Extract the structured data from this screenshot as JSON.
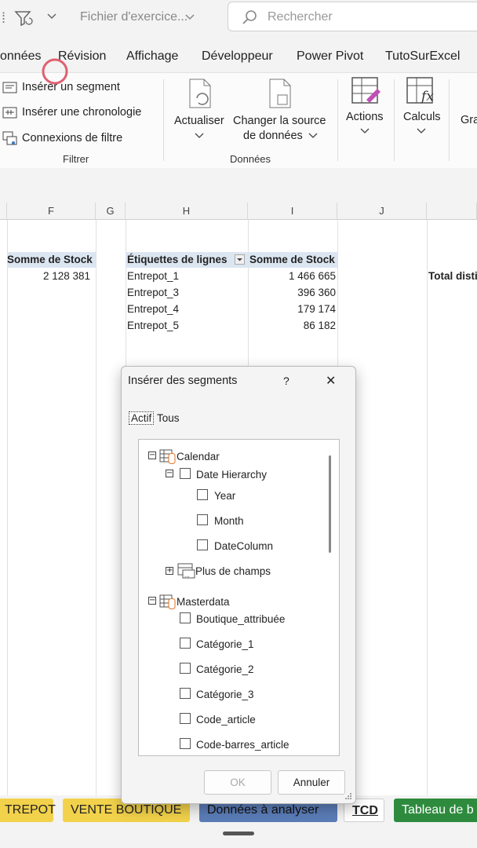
{
  "titlebar": {
    "filename": "Fichier d'exercice...",
    "search_placeholder": "Rechercher"
  },
  "menu": [
    "onnées",
    "Révision",
    "Affichage",
    "Développeur",
    "Power Pivot",
    "TutoSurExcel"
  ],
  "ribbon": {
    "filter_group": {
      "insert_slicer": "Insérer un segment",
      "insert_timeline": "Insérer une chronologie",
      "filter_connections": "Connexions de filtre",
      "label": "Filtrer"
    },
    "data_group": {
      "refresh": "Actualiser",
      "change_source_line1": "Changer la source",
      "change_source_line2": "de données",
      "label": "Données"
    },
    "actions": "Actions",
    "calculs": "Calculs",
    "gra": "Gra"
  },
  "sheet": {
    "columns": [
      "F",
      "G",
      "H",
      "I",
      "J"
    ],
    "f_header": "Somme de Stock",
    "f_value": "2 128 381",
    "row_labels_header": "Étiquettes de lignes",
    "sum_header": "Somme de Stock",
    "rows": [
      {
        "label": "Entrepot_1",
        "value": "1 466 665"
      },
      {
        "label": "Entrepot_3",
        "value": "396 360"
      },
      {
        "label": "Entrepot_4",
        "value": "179 174"
      },
      {
        "label": "Entrepot_5",
        "value": "86 182"
      }
    ],
    "total_text": "Total disti"
  },
  "sheet_tabs": [
    {
      "label": "TREPOT",
      "color": "#f2d24b"
    },
    {
      "label": "VENTE BOUTIQUE",
      "color": "#f2d24b"
    },
    {
      "label": "Données à analyser",
      "color": "#5b7db8"
    },
    {
      "label": "TCD",
      "color": "#ffffff"
    },
    {
      "label": "Tableau de b",
      "color": "#2e8b3e"
    }
  ],
  "dialog": {
    "title": "Insérer des segments",
    "help": "?",
    "close": "✕",
    "tab_active": "Actif",
    "tab_all": "Tous",
    "tree": {
      "calendar": "Calendar",
      "date_hierarchy": "Date Hierarchy",
      "year": "Year",
      "month": "Month",
      "datecolumn": "DateColumn",
      "more_fields": "Plus de champs",
      "masterdata": "Masterdata",
      "fields": [
        "Boutique_attribuée",
        "Catégorie_1",
        "Catégorie_2",
        "Catégorie_3",
        "Code_article",
        "Code-barres_article"
      ]
    },
    "ok": "OK",
    "cancel": "Annuler"
  }
}
